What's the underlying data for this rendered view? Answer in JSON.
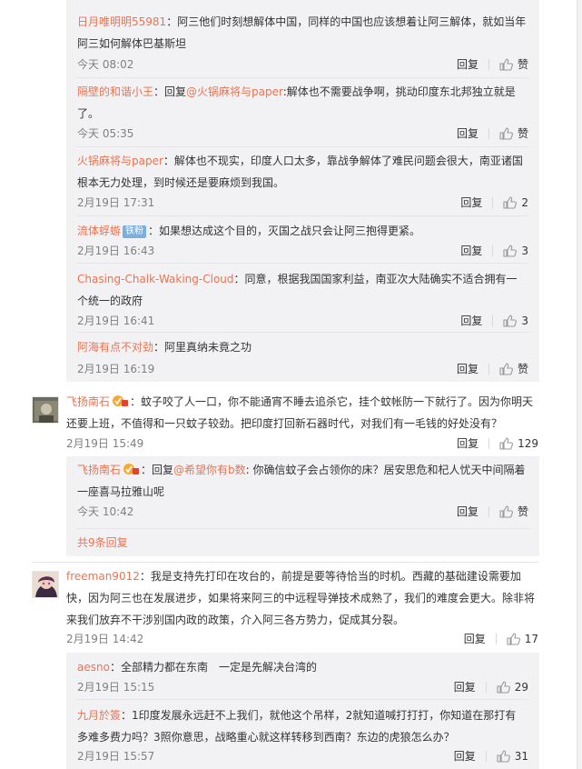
{
  "colors": {
    "link": "#eb7350",
    "panel_bg": "#f2f2f5",
    "meta": "#808080",
    "badge": "#7aafe0"
  },
  "actions": {
    "reply": "回复",
    "like": "赞"
  },
  "thread1": {
    "replies": [
      {
        "user": "日月唯明明55981",
        "sep": "：",
        "text": "阿三他们时刻想解体中国，同样的中国也应该想着让阿三解体，就如当年阿三如何解体巴基斯坦",
        "time": "今天 08:02",
        "likes": "赞"
      },
      {
        "user": "隔壁的和谐小王",
        "sep": "：回复",
        "mention": "@火锅麻将与paper",
        "text": ":解体也不需要战争啊，挑动印度东北邦独立就是了。",
        "time": "今天 05:35",
        "likes": "赞"
      },
      {
        "user": "火锅麻将与paper",
        "sep": "：",
        "text": "解体也不现实，印度人口太多，靠战争解体了难民问题会很大，南亚诸国根本无力处理，到时候还是要麻烦到我国。",
        "time": "2月19日 17:31",
        "likes": "2"
      },
      {
        "user": "流体蜉蝣",
        "badge": "铁粉",
        "sep": "：",
        "text": "如果想达成这个目的，灭国之战只会让阿三抱得更紧。",
        "time": "2月19日 16:43",
        "likes": "3"
      },
      {
        "user": "Chasing-Chalk-Waking-Cloud",
        "sep": "：",
        "text": "同意，根据我国国家利益，南亚次大陆确实不适合拥有一个统一的政府",
        "time": "2月19日 16:41",
        "likes": "3"
      },
      {
        "user": "阿海有点不对劲",
        "sep": "：",
        "text": "阿里真纳未竟之功",
        "time": "2月19日 16:19",
        "likes": "赞"
      }
    ]
  },
  "comment2": {
    "user": "飞扬南石",
    "sep": "：",
    "text": "蚊子咬了人一口，你不能通宵不睡去追杀它，挂个蚊帐防一下就行了。因为你明天还要上班，不值得和一只蚊子较劲。把印度打回新石器时代，对我们有一毛钱的好处没有？",
    "time": "2月19日 15:49",
    "likes": "129",
    "reply": {
      "user": "飞扬南石",
      "sep": "：回复",
      "mention": "@希望你有b数",
      "text": ": 你确信蚊子会占领你的床？居安思危和杞人忧天中间隔着一座喜马拉雅山呢",
      "time": "今天 10:42",
      "likes": "赞"
    },
    "more": "共9条回复"
  },
  "comment3": {
    "user": "freeman9012",
    "sep": "：",
    "text": "我是支持先打印在攻台的，前提是要等待恰当的时机。西藏的基础建设需要加快，因为阿三也在发展进步，如果将来阿三的中远程导弹技术成熟了，我们的难度会更大。除非将来我们放弃不干涉别国内政的政策，介入阿三各方势力，促成其分裂。",
    "time": "2月19日 14:42",
    "likes": "17",
    "replies": [
      {
        "user": "aesno",
        "sep": "：",
        "text": "全部精力都在东南　一定是先解决台湾的",
        "time": "2月19日 15:15",
        "likes": "29"
      },
      {
        "user": "九月於簽",
        "sep": "：",
        "text": "1印度发展永远赶不上我们，就他这个吊样，2就知道喊打打打，你知道在那打有多难多费力吗？3照你意思，战略重心就这样转移到西南？东边的虎狼怎么办？",
        "time": "2月19日 15:57",
        "likes": "31"
      }
    ]
  }
}
